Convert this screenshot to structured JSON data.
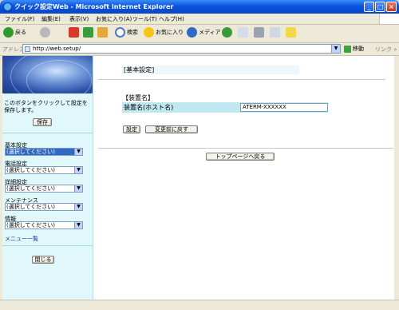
{
  "window": {
    "title": "クイック設定Web - Microsoft Internet Explorer"
  },
  "menu": [
    "ファイル(F)",
    "編集(E)",
    "表示(V)",
    "お気に入り(A)",
    "ツール(T)",
    "ヘルプ(H)"
  ],
  "toolbar": {
    "back": "戻る",
    "search": "検索",
    "favorites": "お気に入り",
    "media": "メディア"
  },
  "address": {
    "label": "アドレス(D)",
    "url": "http://web.setup/",
    "go": "移動",
    "links": "リンク »"
  },
  "sidebar": {
    "help_text": "このボタンをクリックして設定を保存します。",
    "save_button": "保存",
    "menus": [
      {
        "label": "基本設定",
        "value": "(選択してください)"
      },
      {
        "label": "電話設定",
        "value": "(選択してください)"
      },
      {
        "label": "詳細設定",
        "value": "(選択してください)"
      },
      {
        "label": "メンテナンス",
        "value": "(選択してください)"
      },
      {
        "label": "情報",
        "value": "(選択してください)"
      }
    ],
    "menu_list_link": "メニュー一覧",
    "close_button": "閉じる"
  },
  "main": {
    "page_title": "[基本設定]",
    "section_title": "【装置名】",
    "field_label": "装置名(ホスト名)",
    "field_value": "ATERM-XXXXXX",
    "set_button": "設定",
    "revert_button": "変更前に戻す",
    "top_button": "トップページへ戻る"
  }
}
